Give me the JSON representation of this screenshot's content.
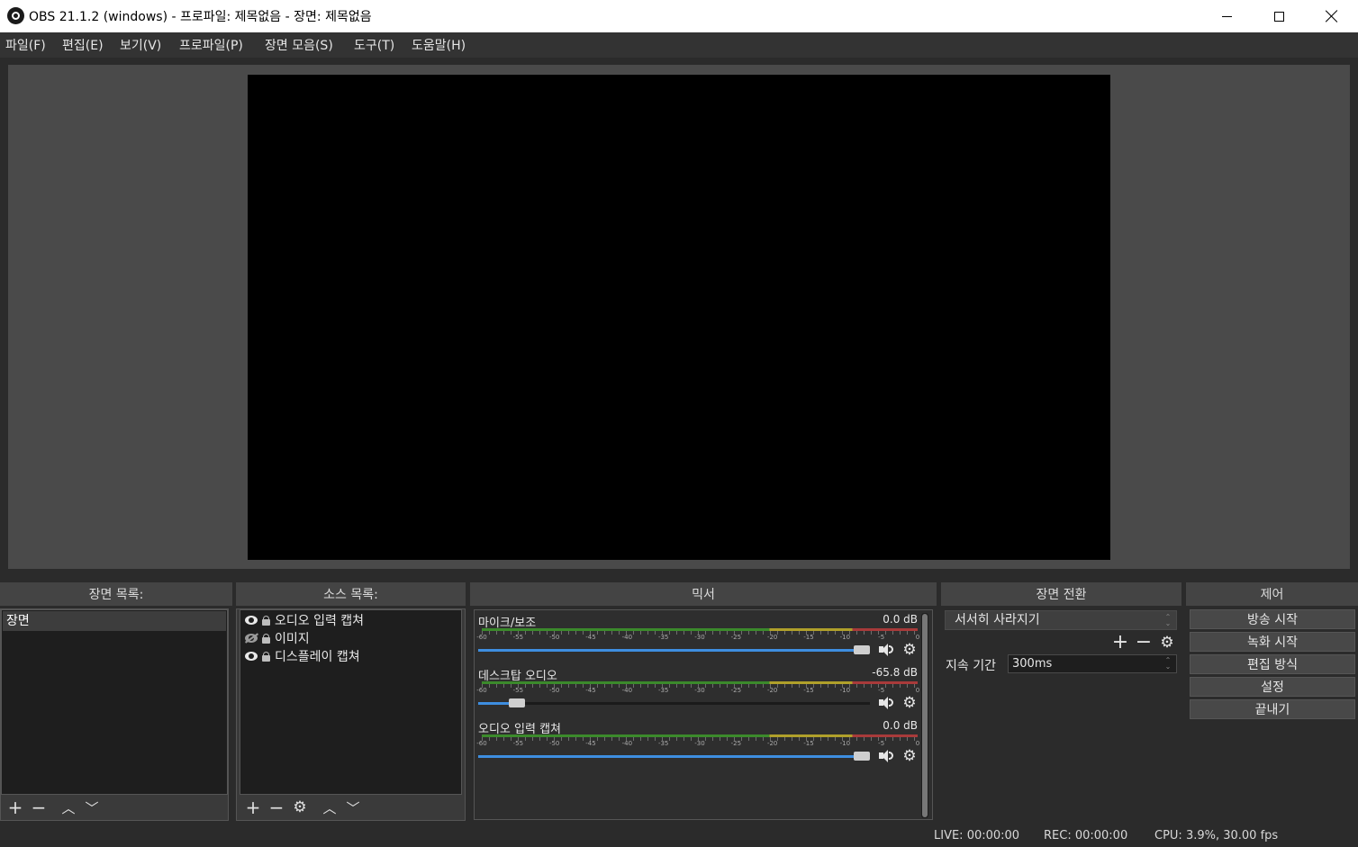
{
  "window": {
    "title": "OBS 21.1.2 (windows) - 프로파일: 제목없음 - 장면: 제목없음"
  },
  "menu": [
    {
      "label": "파일(F)"
    },
    {
      "label": "편집(E)"
    },
    {
      "label": "보기(V)"
    },
    {
      "label": "프로파일(P)"
    },
    {
      "label": "장면 모음(S)"
    },
    {
      "label": "도구(T)"
    },
    {
      "label": "도움말(H)"
    }
  ],
  "docks": {
    "scenes": {
      "title": "장면 목록:",
      "items": [
        "장면"
      ]
    },
    "sources": {
      "title": "소스 목록:",
      "items": [
        {
          "label": "오디오 입력 캡쳐",
          "visible": true
        },
        {
          "label": "이미지",
          "visible": false
        },
        {
          "label": "디스플레이 캡쳐",
          "visible": true
        }
      ]
    },
    "mixer": {
      "title": "믹서",
      "tick_labels": [
        "-60",
        "-55",
        "-50",
        "-45",
        "-40",
        "-35",
        "-30",
        "-25",
        "-20",
        "-15",
        "-10",
        "-5",
        "0"
      ],
      "channels": [
        {
          "name": "마이크/보조",
          "db": "0.0 dB",
          "volume": 1.0
        },
        {
          "name": "데스크탑 오디오",
          "db": "-65.8 dB",
          "volume": 0.1
        },
        {
          "name": "오디오 입력 캡쳐",
          "db": "0.0 dB",
          "volume": 1.0
        }
      ]
    },
    "transitions": {
      "title": "장면 전환",
      "selected": "서서히 사라지기",
      "duration_label": "지속 기간",
      "duration_value": "300ms"
    },
    "controls": {
      "title": "제어",
      "buttons": [
        "방송 시작",
        "녹화 시작",
        "편집 방식",
        "설정",
        "끝내기"
      ]
    }
  },
  "status": {
    "live": "LIVE: 00:00:00",
    "rec": "REC: 00:00:00",
    "cpu": "CPU: 3.9%, 30.00 fps"
  },
  "colors": {
    "fader_fill": "#3e8ee0",
    "meter_green": "#3b8a2b",
    "meter_yellow": "#b0a02a",
    "meter_red": "#a83a3a"
  }
}
